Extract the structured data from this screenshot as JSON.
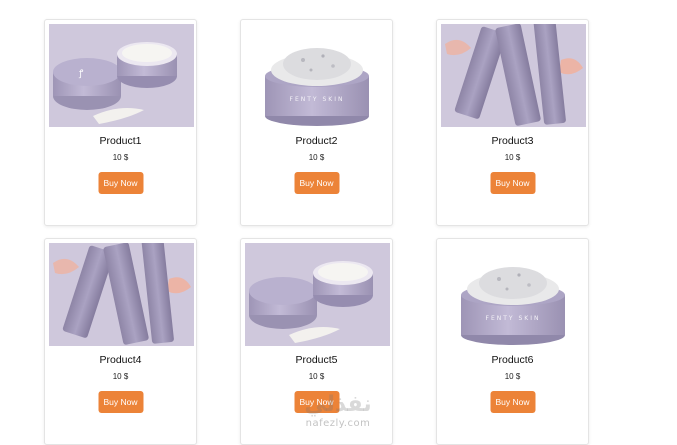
{
  "products": [
    {
      "name": "Product1",
      "price": "10 $",
      "button": "Buy Now",
      "image": "cream-jar-open-lavender-bg"
    },
    {
      "name": "Product2",
      "price": "10 $",
      "button": "Buy Now",
      "image": "fenty-skin-jar-white-bg"
    },
    {
      "name": "Product3",
      "price": "10 $",
      "button": "Buy Now",
      "image": "tubes-lavender-bg"
    },
    {
      "name": "Product4",
      "price": "10 $",
      "button": "Buy Now",
      "image": "tubes-lavender-bg"
    },
    {
      "name": "Product5",
      "price": "10 $",
      "button": "Buy Now",
      "image": "cream-jar-open-lavender-bg"
    },
    {
      "name": "Product6",
      "price": "10 $",
      "button": "Buy Now",
      "image": "fenty-skin-jar-white-bg"
    }
  ],
  "jar_label": "FENTY SKIN",
  "watermark": {
    "arabic": "نفذلي",
    "latin": "nafezly.com"
  },
  "colors": {
    "button": "#ec8338",
    "button_text": "#ffffff",
    "jar": "#b3aac9",
    "background_lavender": "#cfc8dc"
  }
}
